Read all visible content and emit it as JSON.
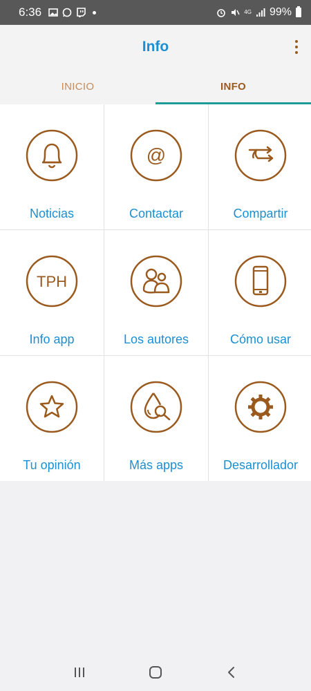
{
  "status_bar": {
    "time": "6:36",
    "battery_text": "99%",
    "network": "4G"
  },
  "app_bar": {
    "title": "Info",
    "menu_icon": "more-vertical-icon"
  },
  "tabs": [
    {
      "label": "INICIO",
      "active": false
    },
    {
      "label": "INFO",
      "active": true
    }
  ],
  "grid": {
    "items": [
      {
        "label": "Noticias",
        "icon": "bell-icon"
      },
      {
        "label": "Contactar",
        "icon": "at-sign-icon"
      },
      {
        "label": "Compartir",
        "icon": "share-arrows-icon"
      },
      {
        "label": "Info app",
        "icon": "tph-icon",
        "icon_text": "TPH"
      },
      {
        "label": "Los autores",
        "icon": "people-icon"
      },
      {
        "label": "Cómo usar",
        "icon": "phone-icon"
      },
      {
        "label": "Tu opinión",
        "icon": "star-icon"
      },
      {
        "label": "Más apps",
        "icon": "drop-search-icon"
      },
      {
        "label": "Desarrollador",
        "icon": "gear-icon"
      }
    ]
  },
  "colors": {
    "accent_blue": "#1b8fd1",
    "icon_brown": "#9a5a1e",
    "tab_indicator": "#1d9b96",
    "status_bar": "#585858"
  },
  "nav_bar": {
    "recents_icon": "recents-icon",
    "home_icon": "home-icon",
    "back_icon": "back-icon"
  }
}
